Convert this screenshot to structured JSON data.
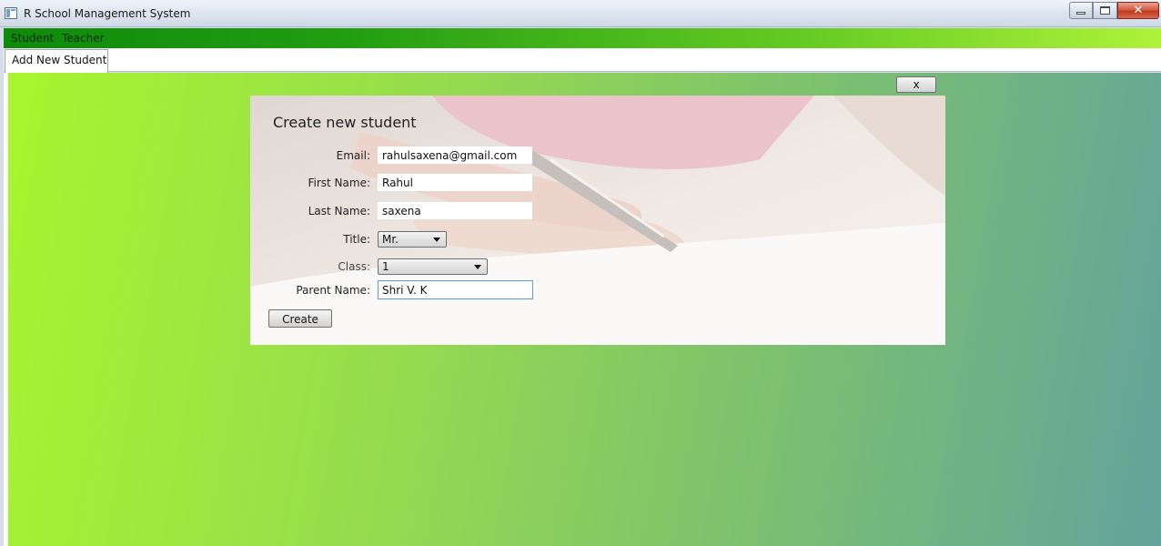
{
  "window": {
    "title": "R School Management System",
    "icon": "app-window-icon",
    "controls": {
      "minimize_icon": "minimize-icon",
      "maximize_icon": "maximize-icon",
      "close_glyph": "✕"
    }
  },
  "menu": {
    "items": [
      {
        "label": "Student"
      },
      {
        "label": "Teacher"
      }
    ],
    "gradient": [
      "#0d8a0a",
      "#aef23a"
    ]
  },
  "tabs": [
    {
      "label": "Add New Student",
      "selected": true
    }
  ],
  "close_panel_button": "x",
  "form": {
    "title": "Create new student",
    "fields": {
      "email": {
        "label": "Email:",
        "value": "rahulsaxena@gmail.com"
      },
      "first_name": {
        "label": "First Name:",
        "value": "Rahul"
      },
      "last_name": {
        "label": "Last Name:",
        "value": "saxena"
      },
      "title": {
        "label": "Title:",
        "value": "Mr."
      },
      "class": {
        "label": "Class:",
        "value": "1"
      },
      "parent_name": {
        "label": "Parent Name:",
        "value": "Shri V. K"
      }
    },
    "submit_label": "Create"
  },
  "colors": {
    "background_gradient": [
      "#a8f52e",
      "#64a39c"
    ],
    "focus_border": "#5b9bd6"
  }
}
